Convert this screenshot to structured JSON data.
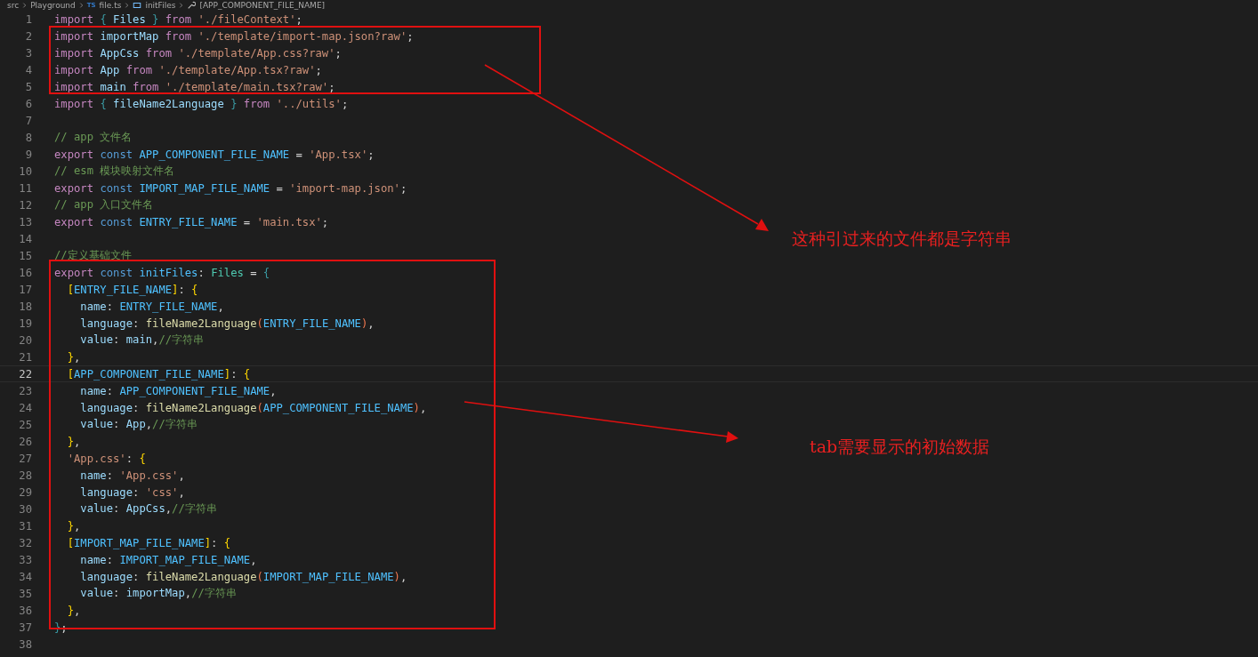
{
  "breadcrumb": [
    {
      "label": "src",
      "kind": "folder"
    },
    {
      "label": "Playground",
      "kind": "folder"
    },
    {
      "label": "file.ts",
      "kind": "ts-file",
      "badge": "TS"
    },
    {
      "label": "initFiles",
      "kind": "variable"
    },
    {
      "label": "[APP_COMPONENT_FILE_NAME]",
      "kind": "property"
    }
  ],
  "lines": [
    {
      "n": "1",
      "current": false,
      "tokens": [
        {
          "kind": "keyword",
          "text": "import "
        },
        {
          "kind": "brace",
          "text": "{ "
        },
        {
          "kind": "variable",
          "text": "Files "
        },
        {
          "kind": "brace",
          "text": "} "
        },
        {
          "kind": "keyword",
          "text": "from "
        },
        {
          "kind": "string",
          "text": "'./fileContext'"
        },
        {
          "kind": "punct",
          "text": ";"
        }
      ]
    },
    {
      "n": "2",
      "current": false,
      "tokens": [
        {
          "kind": "keyword",
          "text": "import "
        },
        {
          "kind": "variable",
          "text": "importMap "
        },
        {
          "kind": "keyword",
          "text": "from "
        },
        {
          "kind": "string",
          "text": "'./template/import-map.json?raw'"
        },
        {
          "kind": "punct",
          "text": ";"
        }
      ]
    },
    {
      "n": "3",
      "current": false,
      "tokens": [
        {
          "kind": "keyword",
          "text": "import "
        },
        {
          "kind": "variable",
          "text": "AppCss "
        },
        {
          "kind": "keyword",
          "text": "from "
        },
        {
          "kind": "string",
          "text": "'./template/App.css?raw'"
        },
        {
          "kind": "punct",
          "text": ";"
        }
      ]
    },
    {
      "n": "4",
      "current": false,
      "tokens": [
        {
          "kind": "keyword",
          "text": "import "
        },
        {
          "kind": "variable",
          "text": "App "
        },
        {
          "kind": "keyword",
          "text": "from "
        },
        {
          "kind": "string",
          "text": "'./template/App.tsx?raw'"
        },
        {
          "kind": "punct",
          "text": ";"
        }
      ]
    },
    {
      "n": "5",
      "current": false,
      "tokens": [
        {
          "kind": "keyword",
          "text": "import "
        },
        {
          "kind": "variable",
          "text": "main "
        },
        {
          "kind": "keyword",
          "text": "from "
        },
        {
          "kind": "string",
          "text": "'./template/main.tsx?raw'"
        },
        {
          "kind": "punct",
          "text": ";"
        }
      ]
    },
    {
      "n": "6",
      "current": false,
      "tokens": [
        {
          "kind": "keyword",
          "text": "import "
        },
        {
          "kind": "brace",
          "text": "{ "
        },
        {
          "kind": "variable",
          "text": "fileName2Language "
        },
        {
          "kind": "brace",
          "text": "} "
        },
        {
          "kind": "keyword",
          "text": "from "
        },
        {
          "kind": "string",
          "text": "'../utils'"
        },
        {
          "kind": "punct",
          "text": ";"
        }
      ]
    },
    {
      "n": "7",
      "current": false
    },
    {
      "n": "8",
      "current": false,
      "tokens": [
        {
          "kind": "comment",
          "text": "// app 文件名"
        }
      ]
    },
    {
      "n": "9",
      "current": false,
      "tokens": [
        {
          "kind": "keyword",
          "text": "export "
        },
        {
          "kind": "storage",
          "text": "const "
        },
        {
          "kind": "constant",
          "text": "APP_COMPONENT_FILE_NAME"
        },
        {
          "kind": "punct",
          "text": " = "
        },
        {
          "kind": "string",
          "text": "'App.tsx'"
        },
        {
          "kind": "punct",
          "text": ";"
        }
      ]
    },
    {
      "n": "10",
      "current": false,
      "tokens": [
        {
          "kind": "comment",
          "text": "// esm 模块映射文件名"
        }
      ]
    },
    {
      "n": "11",
      "current": false,
      "tokens": [
        {
          "kind": "keyword",
          "text": "export "
        },
        {
          "kind": "storage",
          "text": "const "
        },
        {
          "kind": "constant",
          "text": "IMPORT_MAP_FILE_NAME"
        },
        {
          "kind": "punct",
          "text": " = "
        },
        {
          "kind": "string",
          "text": "'import-map.json'"
        },
        {
          "kind": "punct",
          "text": ";"
        }
      ]
    },
    {
      "n": "12",
      "current": false,
      "tokens": [
        {
          "kind": "comment",
          "text": "// app 入口文件名"
        }
      ]
    },
    {
      "n": "13",
      "current": false,
      "tokens": [
        {
          "kind": "keyword",
          "text": "export "
        },
        {
          "kind": "storage",
          "text": "const "
        },
        {
          "kind": "constant",
          "text": "ENTRY_FILE_NAME"
        },
        {
          "kind": "punct",
          "text": " = "
        },
        {
          "kind": "string",
          "text": "'main.tsx'"
        },
        {
          "kind": "punct",
          "text": ";"
        }
      ]
    },
    {
      "n": "14",
      "current": false
    },
    {
      "n": "15",
      "current": false,
      "tokens": [
        {
          "kind": "comment",
          "text": "//定义基础文件"
        }
      ]
    },
    {
      "n": "16",
      "current": false,
      "tokens": [
        {
          "kind": "keyword",
          "text": "export "
        },
        {
          "kind": "storage",
          "text": "const "
        },
        {
          "kind": "constant",
          "text": "initFiles"
        },
        {
          "kind": "punct",
          "text": ": "
        },
        {
          "kind": "type",
          "text": "Files"
        },
        {
          "kind": "punct",
          "text": " = "
        },
        {
          "kind": "brace",
          "text": "{"
        }
      ]
    },
    {
      "n": "17",
      "current": false,
      "tokens": [
        {
          "kind": "bracket",
          "text": "  ["
        },
        {
          "kind": "constant",
          "text": "ENTRY_FILE_NAME"
        },
        {
          "kind": "bracket",
          "text": "]"
        },
        {
          "kind": "punct",
          "text": ": "
        },
        {
          "kind": "bracket",
          "text": "{"
        }
      ]
    },
    {
      "n": "18",
      "current": false,
      "tokens": [
        {
          "kind": "variable",
          "text": "    name"
        },
        {
          "kind": "punct",
          "text": ": "
        },
        {
          "kind": "constant",
          "text": "ENTRY_FILE_NAME"
        },
        {
          "kind": "punct",
          "text": ","
        }
      ]
    },
    {
      "n": "19",
      "current": false,
      "tokens": [
        {
          "kind": "variable",
          "text": "    language"
        },
        {
          "kind": "punct",
          "text": ": "
        },
        {
          "kind": "function",
          "text": "fileName2Language"
        },
        {
          "kind": "paren",
          "text": "("
        },
        {
          "kind": "constant",
          "text": "ENTRY_FILE_NAME"
        },
        {
          "kind": "paren",
          "text": ")"
        },
        {
          "kind": "punct",
          "text": ","
        }
      ]
    },
    {
      "n": "20",
      "current": false,
      "tokens": [
        {
          "kind": "variable",
          "text": "    value"
        },
        {
          "kind": "punct",
          "text": ": "
        },
        {
          "kind": "variable",
          "text": "main"
        },
        {
          "kind": "punct",
          "text": ","
        },
        {
          "kind": "comment",
          "text": "//字符串"
        }
      ]
    },
    {
      "n": "21",
      "current": false,
      "tokens": [
        {
          "kind": "bracket",
          "text": "  }"
        },
        {
          "kind": "punct",
          "text": ","
        }
      ]
    },
    {
      "n": "22",
      "current": true,
      "tokens": [
        {
          "kind": "bracket",
          "text": "  ["
        },
        {
          "kind": "constant",
          "text": "APP_COMPONENT_FILE_NAME"
        },
        {
          "kind": "bracket",
          "text": "]"
        },
        {
          "kind": "punct",
          "text": ": "
        },
        {
          "kind": "bracket",
          "text": "{"
        }
      ]
    },
    {
      "n": "23",
      "current": false,
      "tokens": [
        {
          "kind": "variable",
          "text": "    name"
        },
        {
          "kind": "punct",
          "text": ": "
        },
        {
          "kind": "constant",
          "text": "APP_COMPONENT_FILE_NAME"
        },
        {
          "kind": "punct",
          "text": ","
        }
      ]
    },
    {
      "n": "24",
      "current": false,
      "tokens": [
        {
          "kind": "variable",
          "text": "    language"
        },
        {
          "kind": "punct",
          "text": ": "
        },
        {
          "kind": "function",
          "text": "fileName2Language"
        },
        {
          "kind": "paren",
          "text": "("
        },
        {
          "kind": "constant",
          "text": "APP_COMPONENT_FILE_NAME"
        },
        {
          "kind": "paren",
          "text": ")"
        },
        {
          "kind": "punct",
          "text": ","
        }
      ]
    },
    {
      "n": "25",
      "current": false,
      "tokens": [
        {
          "kind": "variable",
          "text": "    value"
        },
        {
          "kind": "punct",
          "text": ": "
        },
        {
          "kind": "variable",
          "text": "App"
        },
        {
          "kind": "punct",
          "text": ","
        },
        {
          "kind": "comment",
          "text": "//字符串"
        }
      ]
    },
    {
      "n": "26",
      "current": false,
      "tokens": [
        {
          "kind": "bracket",
          "text": "  }"
        },
        {
          "kind": "punct",
          "text": ","
        }
      ]
    },
    {
      "n": "27",
      "current": false,
      "tokens": [
        {
          "kind": "string",
          "text": "  'App.css'"
        },
        {
          "kind": "punct",
          "text": ": "
        },
        {
          "kind": "bracket",
          "text": "{"
        }
      ]
    },
    {
      "n": "28",
      "current": false,
      "tokens": [
        {
          "kind": "variable",
          "text": "    name"
        },
        {
          "kind": "punct",
          "text": ": "
        },
        {
          "kind": "string",
          "text": "'App.css'"
        },
        {
          "kind": "punct",
          "text": ","
        }
      ]
    },
    {
      "n": "29",
      "current": false,
      "tokens": [
        {
          "kind": "variable",
          "text": "    language"
        },
        {
          "kind": "punct",
          "text": ": "
        },
        {
          "kind": "string",
          "text": "'css'"
        },
        {
          "kind": "punct",
          "text": ","
        }
      ]
    },
    {
      "n": "30",
      "current": false,
      "tokens": [
        {
          "kind": "variable",
          "text": "    value"
        },
        {
          "kind": "punct",
          "text": ": "
        },
        {
          "kind": "variable",
          "text": "AppCss"
        },
        {
          "kind": "punct",
          "text": ","
        },
        {
          "kind": "comment",
          "text": "//字符串"
        }
      ]
    },
    {
      "n": "31",
      "current": false,
      "tokens": [
        {
          "kind": "bracket",
          "text": "  }"
        },
        {
          "kind": "punct",
          "text": ","
        }
      ]
    },
    {
      "n": "32",
      "current": false,
      "tokens": [
        {
          "kind": "bracket",
          "text": "  ["
        },
        {
          "kind": "constant",
          "text": "IMPORT_MAP_FILE_NAME"
        },
        {
          "kind": "bracket",
          "text": "]"
        },
        {
          "kind": "punct",
          "text": ": "
        },
        {
          "kind": "bracket",
          "text": "{"
        }
      ]
    },
    {
      "n": "33",
      "current": false,
      "tokens": [
        {
          "kind": "variable",
          "text": "    name"
        },
        {
          "kind": "punct",
          "text": ": "
        },
        {
          "kind": "constant",
          "text": "IMPORT_MAP_FILE_NAME"
        },
        {
          "kind": "punct",
          "text": ","
        }
      ]
    },
    {
      "n": "34",
      "current": false,
      "tokens": [
        {
          "kind": "variable",
          "text": "    language"
        },
        {
          "kind": "punct",
          "text": ": "
        },
        {
          "kind": "function",
          "text": "fileName2Language"
        },
        {
          "kind": "paren",
          "text": "("
        },
        {
          "kind": "constant",
          "text": "IMPORT_MAP_FILE_NAME"
        },
        {
          "kind": "paren",
          "text": ")"
        },
        {
          "kind": "punct",
          "text": ","
        }
      ]
    },
    {
      "n": "35",
      "current": false,
      "tokens": [
        {
          "kind": "variable",
          "text": "    value"
        },
        {
          "kind": "punct",
          "text": ": "
        },
        {
          "kind": "variable",
          "text": "importMap"
        },
        {
          "kind": "punct",
          "text": ","
        },
        {
          "kind": "comment",
          "text": "//字符串"
        }
      ]
    },
    {
      "n": "36",
      "current": false,
      "tokens": [
        {
          "kind": "bracket",
          "text": "  }"
        },
        {
          "kind": "punct",
          "text": ","
        }
      ]
    },
    {
      "n": "37",
      "current": false,
      "tokens": [
        {
          "kind": "brace",
          "text": "}"
        },
        {
          "kind": "punct",
          "text": ";"
        }
      ]
    },
    {
      "n": "38",
      "current": false
    }
  ],
  "annotations": [
    {
      "text": "这种引过来的文件都是字符串"
    },
    {
      "text": "tab需要显示的初始数据"
    }
  ]
}
